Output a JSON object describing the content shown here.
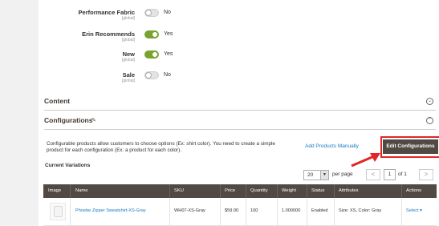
{
  "attributes": [
    {
      "label": "Performance Fabric",
      "scope": "[global]",
      "value": "No",
      "on": false
    },
    {
      "label": "Erin Recommends",
      "scope": "[global]",
      "value": "Yes",
      "on": true
    },
    {
      "label": "New",
      "scope": "[global]",
      "value": "Yes",
      "on": true
    },
    {
      "label": "Sale",
      "scope": "[global]",
      "value": "No",
      "on": false
    }
  ],
  "sections": {
    "content_title": "Content",
    "configurations_title": "Configurations"
  },
  "configurations": {
    "description": "Configurable products allow customers to choose options (Ex: shirt color). You need to create a simple product for each configuration (Ex: a product for each color).",
    "add_manually": "Add Products Manually",
    "edit_button": "Edit Configurations",
    "current_variations": "Current Variations",
    "highlight_color": "#e22626"
  },
  "pager": {
    "page_size": "20",
    "per_page_label": "per page",
    "prev": "<",
    "current_page": "1",
    "of_label": "of 1",
    "next": ">"
  },
  "grid": {
    "columns": [
      "Image",
      "Name",
      "SKU",
      "Price",
      "Quantity",
      "Weight",
      "Status",
      "Attributes",
      "Actions"
    ],
    "rows": [
      {
        "name": "Phoebe Zipper Sweatshirt-XS-Gray",
        "sku": "WH07-XS-Gray",
        "price": "$59.00",
        "quantity": "100",
        "weight": "1.000000",
        "status": "Enabled",
        "attributes": "Size: XS, Color: Gray",
        "action": "Select ▾"
      }
    ]
  }
}
